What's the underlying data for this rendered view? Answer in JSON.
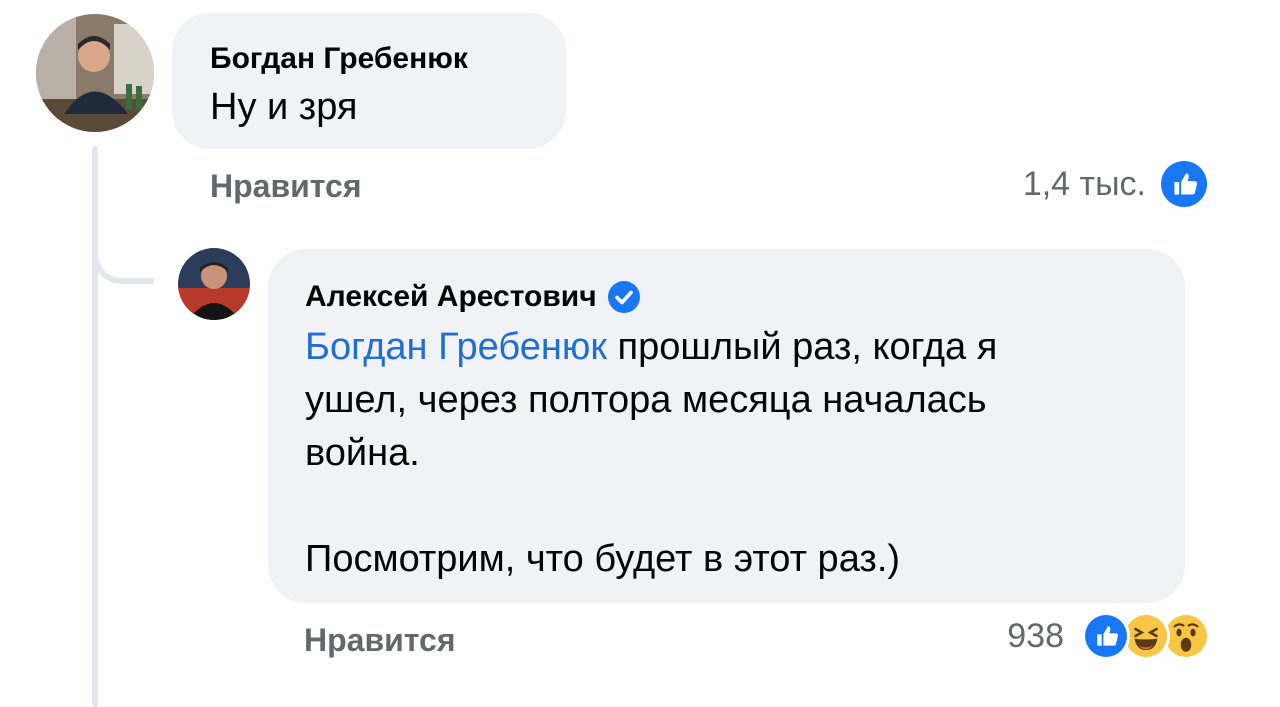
{
  "comment": {
    "author": "Богдан Гребенюк",
    "text": "Ну и зря",
    "like_label": "Нравится",
    "reaction_count": "1,4 тыс.",
    "reactions": [
      "like-icon"
    ]
  },
  "reply": {
    "author": "Алексей Арестович",
    "verified": true,
    "mention": "Богдан Гребенюк",
    "text_line1": " прошлый раз, когда я",
    "text_line2": "ушел, через полтора месяца началась",
    "text_line3": "война.",
    "text_line4": "Посмотрим, что будет в этот раз.)",
    "like_label": "Нравится",
    "reaction_count": "938",
    "reactions": [
      "like-icon",
      "haha-icon",
      "wow-icon"
    ]
  },
  "colors": {
    "bubble": "#f0f2f5",
    "mention": "#1f6ed4",
    "muted": "#65676b",
    "like_blue": "#1877f2"
  }
}
